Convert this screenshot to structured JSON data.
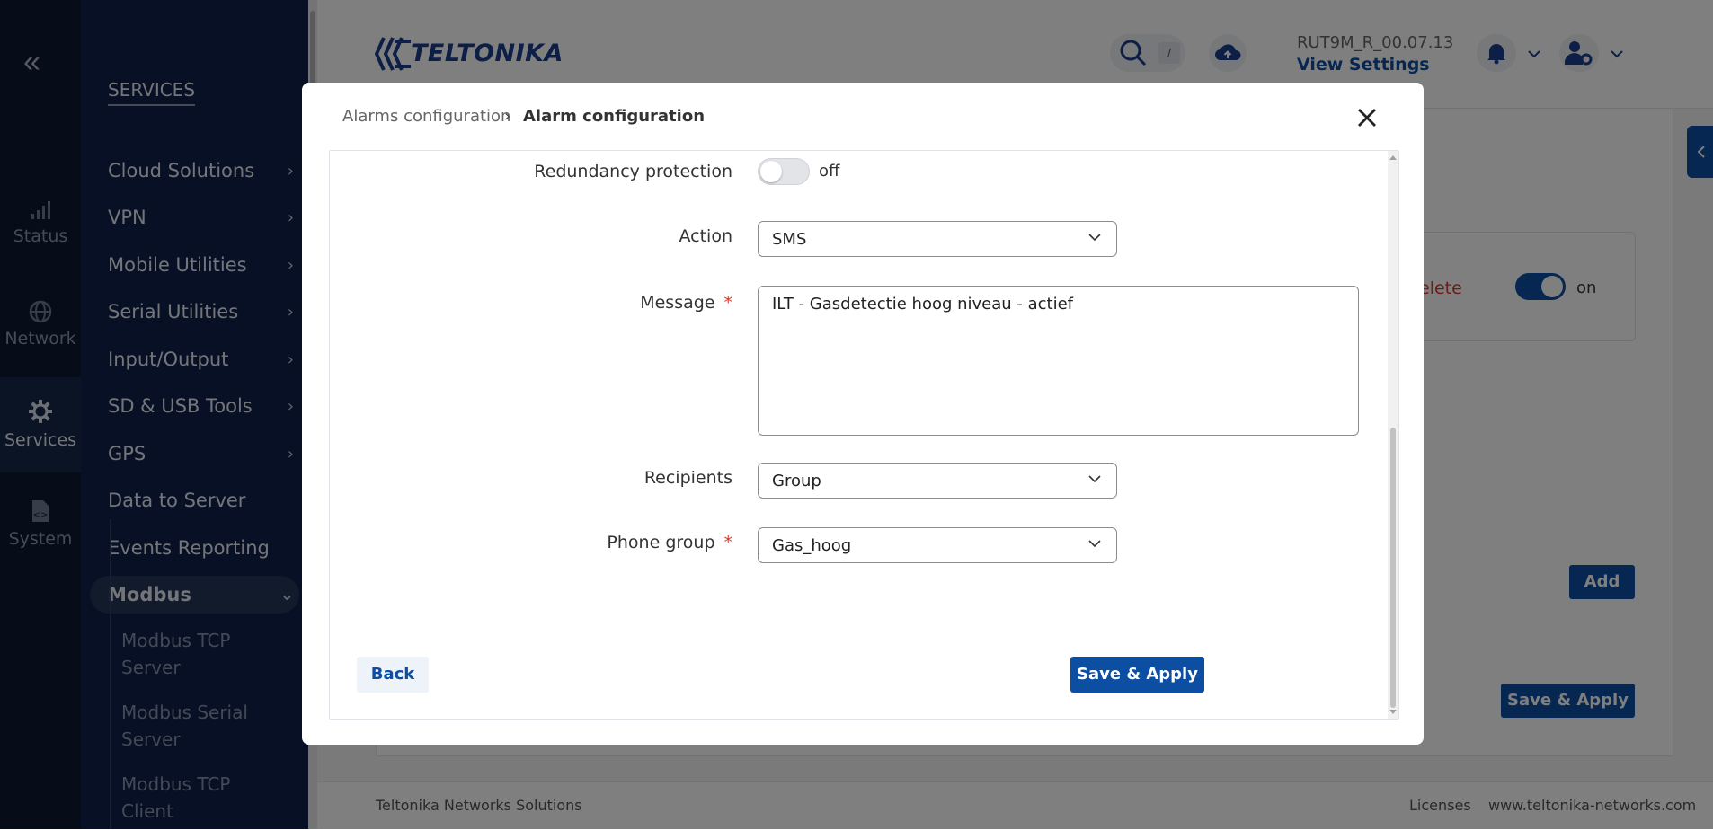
{
  "rail": {
    "collapse_glyph": "«",
    "items": [
      {
        "label": "Status",
        "icon": "signal-bars-icon"
      },
      {
        "label": "Network",
        "icon": "globe-icon"
      },
      {
        "label": "Services",
        "icon": "gear-icon"
      },
      {
        "label": "System",
        "icon": "file-code-icon"
      }
    ]
  },
  "sidebar": {
    "title": "SERVICES",
    "items": [
      {
        "label": "Cloud Solutions",
        "chev": "›"
      },
      {
        "label": "VPN",
        "chev": "›"
      },
      {
        "label": "Mobile Utilities",
        "chev": "›"
      },
      {
        "label": "Serial Utilities",
        "chev": "›"
      },
      {
        "label": "Input/Output",
        "chev": "›"
      },
      {
        "label": "SD & USB Tools",
        "chev": "›"
      },
      {
        "label": "GPS",
        "chev": "›"
      },
      {
        "label": "Data to Server",
        "chev": ""
      },
      {
        "label": "Events Reporting",
        "chev": ""
      },
      {
        "label": "Modbus",
        "chev": "⌄"
      }
    ],
    "modbus_sub": [
      "Modbus TCP Server",
      "Modbus Serial Server",
      "Modbus TCP Client"
    ]
  },
  "header": {
    "logo": "TELTONIKA",
    "search_shortcut": "/",
    "firmware": "RUT9M_R_00.07.13",
    "view_settings": "View Settings"
  },
  "background": {
    "delete_text": "elete",
    "toggle_state": "on",
    "add_label": "Add",
    "save_label": "Save & Apply",
    "footer_left": "Teltonika Networks Solutions",
    "footer_licenses": "Licenses",
    "footer_url": "www.teltonika-networks.com"
  },
  "modal": {
    "breadcrumb_parent": "Alarms configuration",
    "breadcrumb_sep": "›",
    "breadcrumb_current": "Alarm configuration",
    "close_glyph": "✕",
    "fields": {
      "redundancy_label": "Redundancy protection",
      "redundancy_state": "off",
      "action_label": "Action",
      "action_value": "SMS",
      "message_label": "Message",
      "message_value": "ILT - Gasdetectie hoog niveau - actief",
      "recipients_label": "Recipients",
      "recipients_value": "Group",
      "phone_group_label": "Phone group",
      "phone_group_value": "Gas_hoog",
      "required_mark": "*"
    },
    "back_label": "Back",
    "save_apply_label": "Save & Apply"
  },
  "colors": {
    "primary": "#0b4ea2",
    "required": "#d23c2a",
    "sidebar_bg": "#0f2048",
    "rail_bg": "#0d1b33"
  }
}
